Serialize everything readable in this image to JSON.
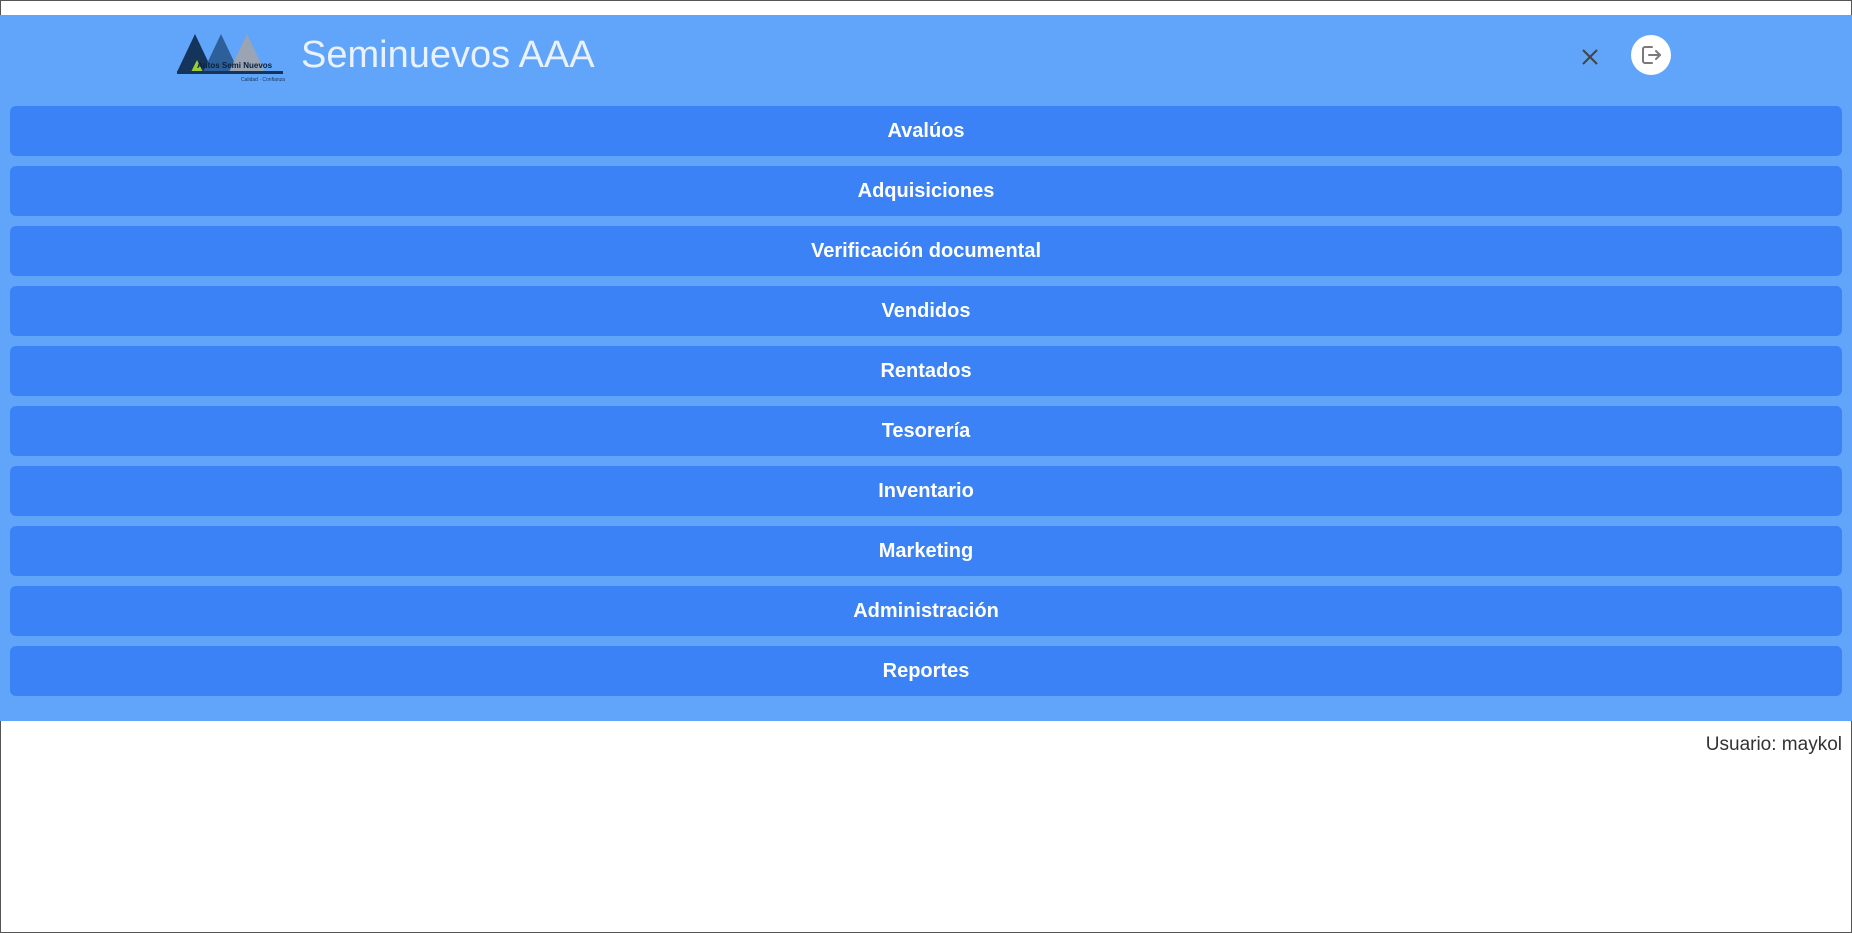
{
  "app": {
    "title": "Seminuevos AAA",
    "logo_text": "Autos Semi Nuevos",
    "logo_tagline": "Calidad · Confianza"
  },
  "header": {
    "close_icon": "close-icon",
    "logout_icon": "logout-icon"
  },
  "menu": {
    "items": [
      {
        "label": "Avalúos"
      },
      {
        "label": "Adquisiciones"
      },
      {
        "label": "Verificación documental"
      },
      {
        "label": "Vendidos"
      },
      {
        "label": "Rentados"
      },
      {
        "label": "Tesorería"
      },
      {
        "label": "Inventario"
      },
      {
        "label": "Marketing"
      },
      {
        "label": "Administración"
      },
      {
        "label": "Reportes"
      }
    ]
  },
  "footer": {
    "user_text": "Usuario: maykol"
  },
  "colors": {
    "panel_bg": "#60a5fa",
    "button_bg": "#3b82f6",
    "button_text": "#ffffff",
    "title_text": "#eaf2ff"
  }
}
